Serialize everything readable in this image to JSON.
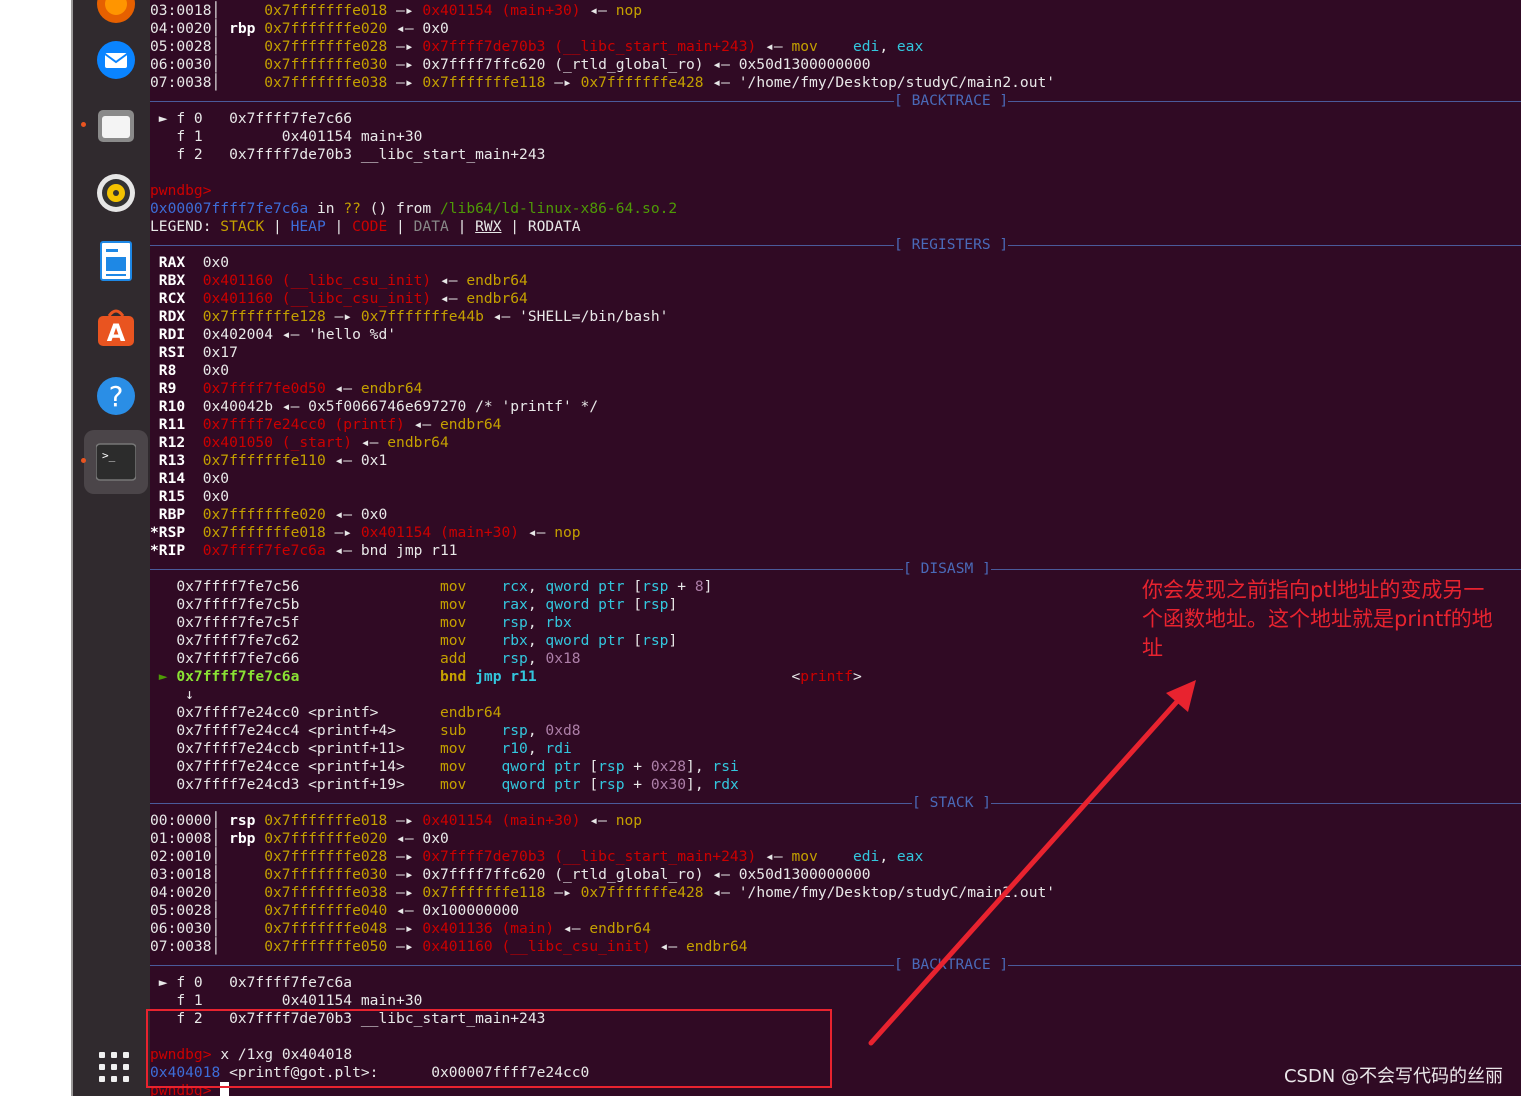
{
  "dock": {
    "items": [
      {
        "name": "firefox",
        "icon": "firefox-icon"
      },
      {
        "name": "thunderbird",
        "icon": "thunderbird-icon"
      },
      {
        "name": "files",
        "icon": "files-icon"
      },
      {
        "name": "rhythmbox",
        "icon": "rhythmbox-icon"
      },
      {
        "name": "writer",
        "icon": "document-icon"
      },
      {
        "name": "software",
        "icon": "software-store-icon"
      },
      {
        "name": "help",
        "icon": "help-icon"
      },
      {
        "name": "terminal",
        "icon": "terminal-icon"
      }
    ],
    "apps_grid_icon": "apps-grid-icon"
  },
  "terminal": {
    "top_stack": [
      {
        "idx": "03:0018",
        "reg": "",
        "addr": "0x7fffffffe018",
        "arrow": " —▸ ",
        "sym": "0x401154 (main+30)",
        "tail_arrow": " ◂— ",
        "tail": "nop"
      },
      {
        "idx": "04:0020",
        "reg": "rbp",
        "addr": "0x7fffffffe020",
        "arrow": " ◂— ",
        "val": "0x0"
      },
      {
        "idx": "05:0028",
        "reg": "",
        "addr": "0x7fffffffe028",
        "arrow": " —▸ ",
        "sym": "0x7ffff7de70b3 (__libc_start_main+243)",
        "tail_arrow": " ◂— ",
        "ins": "mov",
        "ops1": "edi",
        "ops2": "eax"
      },
      {
        "idx": "06:0030",
        "reg": "",
        "addr": "0x7fffffffe030",
        "arrow": " —▸ ",
        "val": "0x7ffff7ffc620 (_rtld_global_ro)",
        "tail_arrow": " ◂— ",
        "tail": "0x50d1300000000"
      },
      {
        "idx": "07:0038",
        "reg": "",
        "addr": "0x7fffffffe038",
        "arrow": " —▸ ",
        "val2": "0x7fffffffe118",
        "arrow2": " —▸ ",
        "val3": "0x7fffffffe428",
        "tail_arrow": " ◂— ",
        "tail": "'/home/fmy/Desktop/studyC/main2.out'"
      }
    ],
    "backtrace_label": "[ BACKTRACE ]",
    "bt1": [
      {
        "mark": "► f 0",
        "addr": "0x7ffff7fe7c66",
        "sym": ""
      },
      {
        "mark": "  f 1",
        "addr": "      0x401154",
        "sym": "main+30"
      },
      {
        "mark": "  f 2",
        "addr": "0x7ffff7de70b3",
        "sym": "__libc_start_main+243"
      }
    ],
    "prompt": "pwndbg>",
    "where": {
      "addr": "0x00007ffff7fe7c6a",
      "in": " in ",
      "q": "??",
      "rest": " () from ",
      "lib": "/lib64/ld-linux-x86-64.so.2"
    },
    "legend": {
      "label": "LEGEND: ",
      "stack": "STACK",
      "heap": "HEAP",
      "code": "CODE",
      "data": "DATA",
      "rwx": "RWX",
      "rodata": "RODATA"
    },
    "registers_label": "[ REGISTERS ]",
    "registers": [
      {
        "name": "RAX",
        "v1": "0x0"
      },
      {
        "name": "RBX",
        "v1": "0x401160 (__libc_csu_init)",
        "arr": " ◂— ",
        "v2": "endbr64",
        "c1": "r",
        "c2": "y"
      },
      {
        "name": "RCX",
        "v1": "0x401160 (__libc_csu_init)",
        "arr": " ◂— ",
        "v2": "endbr64",
        "c1": "r",
        "c2": "y"
      },
      {
        "name": "RDX",
        "v1": "0x7fffffffe128",
        "arr": " —▸ ",
        "v2": "0x7fffffffe44b",
        "arr2": " ◂— ",
        "v3": "'SHELL=/bin/bash'",
        "c1": "y",
        "c2": "y"
      },
      {
        "name": "RDI",
        "v1": "0x402004",
        "arr": " ◂— ",
        "v2": "'hello %d'",
        "c1": "w",
        "c2": "w"
      },
      {
        "name": "RSI",
        "v1": "0x17"
      },
      {
        "name": "R8",
        "v1": "0x0"
      },
      {
        "name": "R9",
        "v1": "0x7ffff7fe0d50",
        "arr": " ◂— ",
        "v2": "endbr64",
        "c1": "r",
        "c2": "y"
      },
      {
        "name": "R10",
        "v1": "0x40042b",
        "arr": " ◂— ",
        "v2": "0x5f0066746e697270 /* 'printf' */",
        "c1": "w",
        "c2": "w"
      },
      {
        "name": "R11",
        "v1": "0x7ffff7e24cc0 (printf)",
        "arr": " ◂— ",
        "v2": "endbr64",
        "c1": "r",
        "c2": "y"
      },
      {
        "name": "R12",
        "v1": "0x401050 (_start)",
        "arr": " ◂— ",
        "v2": "endbr64",
        "c1": "r",
        "c2": "y"
      },
      {
        "name": "R13",
        "v1": "0x7fffffffe110",
        "arr": " ◂— ",
        "v2": "0x1",
        "c1": "y",
        "c2": "w"
      },
      {
        "name": "R14",
        "v1": "0x0"
      },
      {
        "name": "R15",
        "v1": "0x0"
      },
      {
        "name": "RBP",
        "v1": "0x7fffffffe020",
        "arr": " ◂— ",
        "v2": "0x0",
        "c1": "y",
        "c2": "w"
      },
      {
        "name": "*RSP",
        "v1": "0x7fffffffe018",
        "arr": " —▸ ",
        "v2": "0x401154 (main+30)",
        "arr2": " ◂— ",
        "v3": "nop",
        "c1": "y",
        "c2": "r"
      },
      {
        "name": "*RIP",
        "v1": "0x7ffff7fe7c6a",
        "arr": " ◂— ",
        "v2": "bnd jmp r11",
        "c1": "r",
        "c2": "w"
      }
    ],
    "disasm_label": "[ DISASM ]",
    "disasm": [
      {
        "addr": "0x7ffff7fe7c56",
        "ins": "mov",
        "ops": "rcx, qword ptr [rsp + 8]"
      },
      {
        "addr": "0x7ffff7fe7c5b",
        "ins": "mov",
        "ops": "rax, qword ptr [rsp]"
      },
      {
        "addr": "0x7ffff7fe7c5f",
        "ins": "mov",
        "ops": "rsp, rbx"
      },
      {
        "addr": "0x7ffff7fe7c62",
        "ins": "mov",
        "ops": "rbx, qword ptr [rsp]"
      },
      {
        "addr": "0x7ffff7fe7c66",
        "ins": "add",
        "ops": "rsp, 0x18"
      }
    ],
    "cur_ins": {
      "mark": "►",
      "addr": "0x7ffff7fe7c6a",
      "ins": "bnd jmp r11",
      "target_l": "<",
      "target": "printf",
      "target_r": ">"
    },
    "down_arrow": "↓",
    "disasm2": [
      {
        "addr": "0x7ffff7e24cc0 <printf>",
        "ins": "endbr64",
        "ops": ""
      },
      {
        "addr": "0x7ffff7e24cc4 <printf+4>",
        "ins": "sub",
        "ops": "rsp, 0xd8"
      },
      {
        "addr": "0x7ffff7e24ccb <printf+11>",
        "ins": "mov",
        "ops": "r10, rdi"
      },
      {
        "addr": "0x7ffff7e24cce <printf+14>",
        "ins": "mov",
        "ops": "qword ptr [rsp + 0x28], rsi"
      },
      {
        "addr": "0x7ffff7e24cd3 <printf+19>",
        "ins": "mov",
        "ops": "qword ptr [rsp + 0x30], rdx"
      }
    ],
    "stack_label": "[ STACK ]",
    "stack": [
      {
        "idx": "00:0000",
        "reg": "rsp",
        "addr": "0x7fffffffe018",
        "arr": " —▸ ",
        "a": "0x401154 (main+30)",
        "ac": "r",
        "arr2": " ◂— ",
        "b": "nop",
        "bc": "y"
      },
      {
        "idx": "01:0008",
        "reg": "rbp",
        "addr": "0x7fffffffe020",
        "arr": " ◂— ",
        "a": "0x0",
        "ac": "w"
      },
      {
        "idx": "02:0010",
        "reg": "",
        "addr": "0x7fffffffe028",
        "arr": " —▸ ",
        "a": "0x7ffff7de70b3 (__libc_start_main+243)",
        "ac": "r",
        "arr2": " ◂— ",
        "b": "mov",
        "bc": "y",
        "c1": "edi",
        "c2": "eax"
      },
      {
        "idx": "03:0018",
        "reg": "",
        "addr": "0x7fffffffe030",
        "arr": " —▸ ",
        "a": "0x7ffff7ffc620 (_rtld_global_ro)",
        "ac": "w",
        "arr2": " ◂— ",
        "b": "0x50d1300000000",
        "bc": "w"
      },
      {
        "idx": "04:0020",
        "reg": "",
        "addr": "0x7fffffffe038",
        "arr": " —▸ ",
        "a": "0x7fffffffe118",
        "ac": "y",
        "arr2": " —▸ ",
        "b": "0x7fffffffe428",
        "bc": "y",
        "arr3": " ◂— ",
        "d": "'/home/fmy/Desktop/studyC/main2.out'"
      },
      {
        "idx": "05:0028",
        "reg": "",
        "addr": "0x7fffffffe040",
        "arr": " ◂— ",
        "a": "0x100000000",
        "ac": "w"
      },
      {
        "idx": "06:0030",
        "reg": "",
        "addr": "0x7fffffffe048",
        "arr": " —▸ ",
        "a": "0x401136 (main)",
        "ac": "r",
        "arr2": " ◂— ",
        "b": "endbr64",
        "bc": "y"
      },
      {
        "idx": "07:0038",
        "reg": "",
        "addr": "0x7fffffffe050",
        "arr": " —▸ ",
        "a": "0x401160 (__libc_csu_init)",
        "ac": "r",
        "arr2": " ◂— ",
        "b": "endbr64",
        "bc": "y"
      }
    ],
    "bt2": [
      {
        "mark": "► f 0",
        "addr": "0x7ffff7fe7c6a",
        "sym": ""
      },
      {
        "mark": "  f 1",
        "addr": "      0x401154",
        "sym": "main+30"
      },
      {
        "mark": "  f 2",
        "addr": "0x7ffff7de70b3",
        "sym": "__libc_start_main+243"
      }
    ],
    "cmd": "x /1xg 0x404018",
    "result": {
      "addr": "0x404018",
      "sym": "<printf@got.plt>:",
      "val": "0x00007ffff7e24cc0"
    }
  },
  "annotation": {
    "note": "你会发现之前指向ptl地址的变成另一个函数地址。这个地址就是printf的地址",
    "color": "#e8232f"
  },
  "watermark": "CSDN @不会写代码的丝丽"
}
